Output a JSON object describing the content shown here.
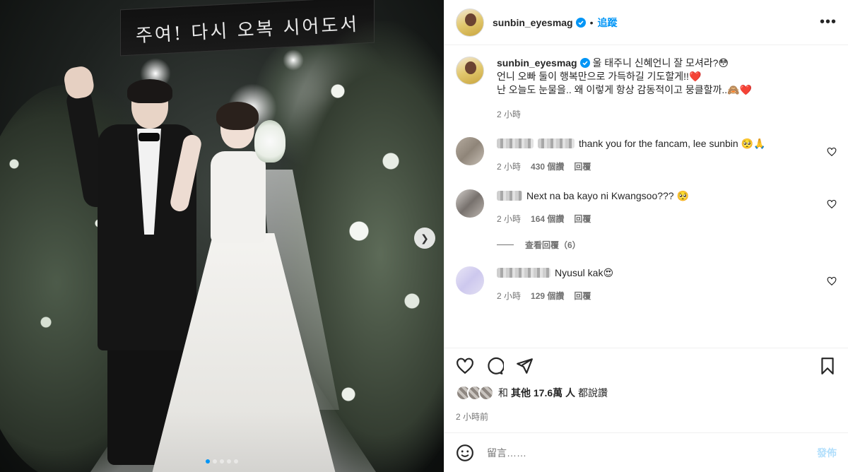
{
  "post": {
    "username": "sunbin_eyesmag",
    "separator": "•",
    "follow_label": "追蹤",
    "more_label": "•••",
    "media": {
      "banner_text": "주여! 다시 오복 시어도서",
      "slide_count": 5,
      "active_slide": 1
    }
  },
  "caption": {
    "username": "sunbin_eyesmag",
    "lines": [
      "울 태주니 신혜언니 잘 모셔라?😳",
      "언니 오빠 둘이 행복만으로 가득하길 기도할게!!❤️",
      "난 오늘도 눈물을.. 왜 이렇게 항상 감동적이고 뭉클할까..🙈❤️"
    ],
    "time": "2 小時"
  },
  "comments": [
    {
      "text": "thank you for the fancam, lee sunbin 🥺🙏",
      "time": "2 小時",
      "likes": "430 個讚",
      "reply_label": "回覆"
    },
    {
      "text": "Next na ba kayo ni Kwangsoo??? 🥺",
      "time": "2 小時",
      "likes": "164 個讚",
      "reply_label": "回覆",
      "view_replies": "查看回覆（6）"
    },
    {
      "text": "Nyusul kak😍",
      "time": "2 小時",
      "likes": "129 個讚",
      "reply_label": "回覆"
    }
  ],
  "likes_summary": {
    "and": "和",
    "others": "其他 17.6萬 人",
    "suffix": "都說讚"
  },
  "posted_ago": "2 小時前",
  "composer": {
    "placeholder": "留言……",
    "post_label": "發佈"
  },
  "colors": {
    "accent": "#0095f6",
    "post_disabled": "#b2dffc",
    "secondary_text": "#737373"
  }
}
